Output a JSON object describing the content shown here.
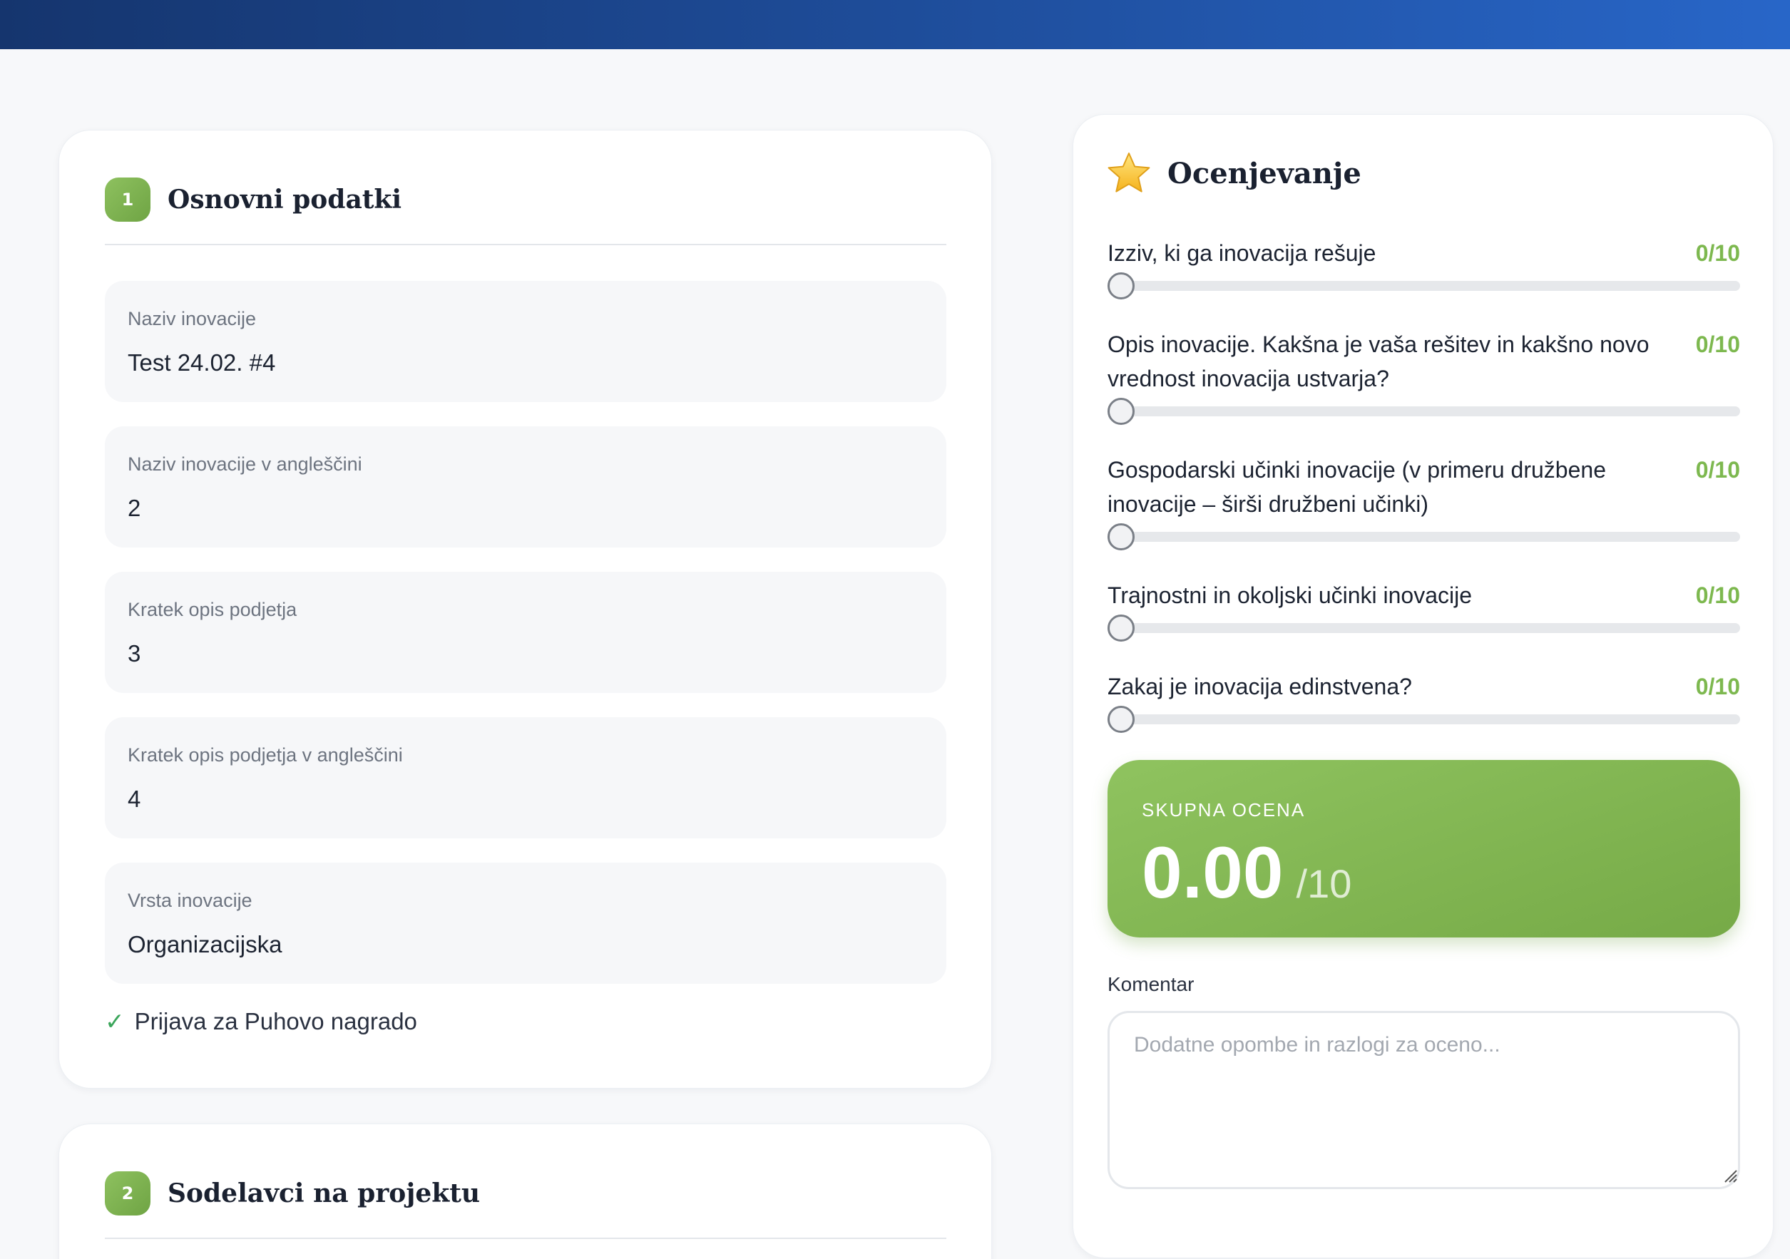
{
  "colors": {
    "header_gradient_start": "#15356e",
    "header_gradient_end": "#2866c8",
    "accent_green": "#7db84f",
    "check_green": "#3aa55a"
  },
  "sections": {
    "basic": {
      "number": "1",
      "title": "Osnovni podatki",
      "fields": [
        {
          "label": "Naziv inovacije",
          "value": "Test 24.02. #4"
        },
        {
          "label": "Naziv inovacije v angleščini",
          "value": "2"
        },
        {
          "label": "Kratek opis podjetja",
          "value": "3"
        },
        {
          "label": "Kratek opis podjetja v angleščini",
          "value": "4"
        },
        {
          "label": "Vrsta inovacije",
          "value": "Organizacijska"
        }
      ],
      "checkbox": {
        "icon": "check-icon",
        "label": "Prijava za Puhovo nagrado",
        "checked": true
      }
    },
    "team": {
      "number": "2",
      "title": "Sodelavci na projektu"
    }
  },
  "rating": {
    "icon": "star-icon",
    "title": "Ocenjevanje",
    "criteria": [
      {
        "label": "Izziv, ki ga inovacija rešuje",
        "score": "0/10",
        "value": 0,
        "max": 10
      },
      {
        "label": "Opis inovacije. Kakšna je vaša rešitev in kakšno novo vrednost inovacija ustvarja?",
        "score": "0/10",
        "value": 0,
        "max": 10
      },
      {
        "label": "Gospodarski učinki inovacije (v primeru družbene inovacije – širši družbeni učinki)",
        "score": "0/10",
        "value": 0,
        "max": 10
      },
      {
        "label": "Trajnostni in okoljski učinki inovacije",
        "score": "0/10",
        "value": 0,
        "max": 10
      },
      {
        "label": "Zakaj je inovacija edinstvena?",
        "score": "0/10",
        "value": 0,
        "max": 10
      }
    ],
    "total": {
      "label": "SKUPNA OCENA",
      "value": "0.00",
      "max": "/10"
    },
    "comment": {
      "label": "Komentar",
      "placeholder": "Dodatne opombe in razlogi za oceno...",
      "value": ""
    }
  }
}
